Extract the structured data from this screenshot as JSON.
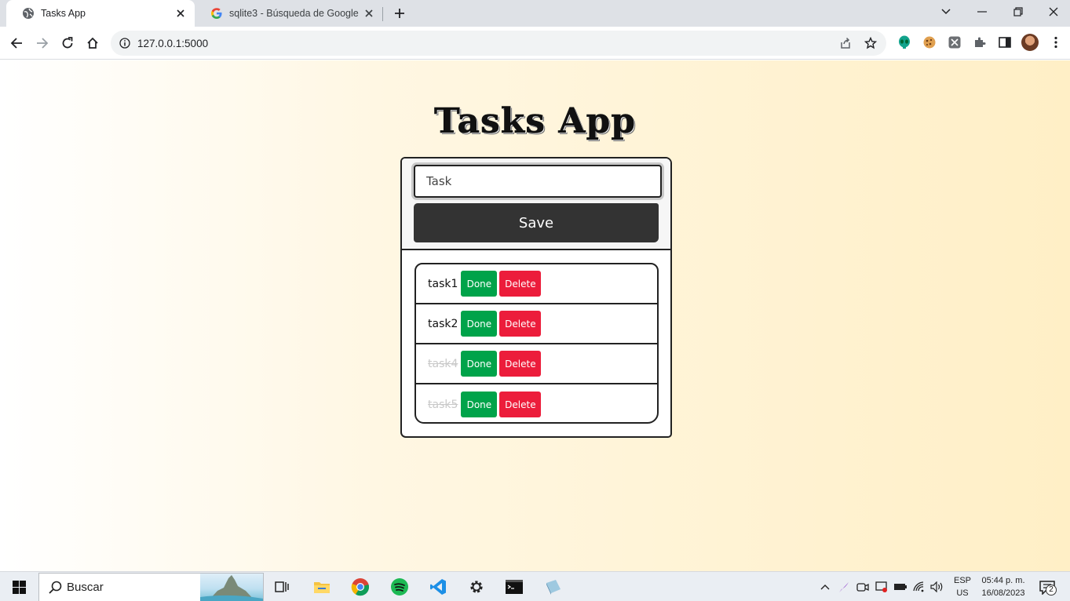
{
  "browser": {
    "tabs": [
      {
        "title": "Tasks App",
        "favicon": "globe-icon",
        "active": true
      },
      {
        "title": "sqlite3 - Búsqueda de Google",
        "favicon": "google-g-icon",
        "active": false
      }
    ],
    "url": "127.0.0.1:5000"
  },
  "app": {
    "title": "Tasks App",
    "input_placeholder": "Task",
    "save_label": "Save",
    "done_label": "Done",
    "delete_label": "Delete",
    "tasks": [
      {
        "name": "task1",
        "done": false
      },
      {
        "name": "task2",
        "done": false
      },
      {
        "name": "task4",
        "done": true
      },
      {
        "name": "task5",
        "done": true
      }
    ]
  },
  "taskbar": {
    "search_label": "Buscar",
    "lang_top": "ESP",
    "lang_bottom": "US",
    "time": "05:44 p. m.",
    "date": "16/08/2023",
    "notifications": "2"
  },
  "colors": {
    "done_green": "#00a34a",
    "delete_red": "#ec1d3b",
    "save_dark": "#333333"
  }
}
